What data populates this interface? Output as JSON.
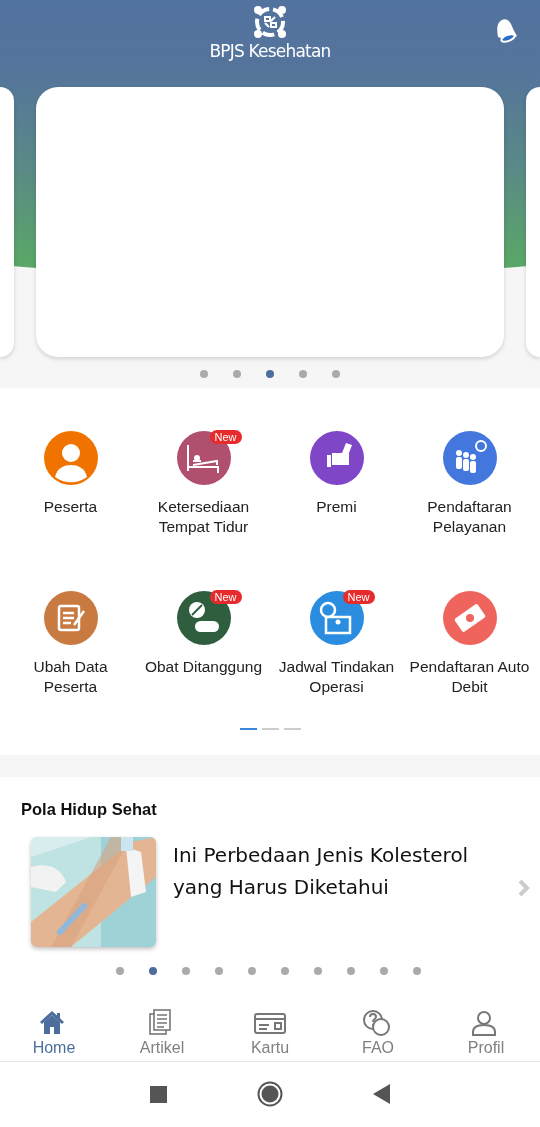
{
  "header": {
    "title": "BPJS Kesehatan"
  },
  "banner": {
    "dots": [
      {
        "selected": false
      },
      {
        "selected": false
      },
      {
        "selected": true
      },
      {
        "selected": false
      },
      {
        "selected": false
      }
    ]
  },
  "menu": {
    "items": [
      {
        "label": "Peserta",
        "color": "#f07300"
      },
      {
        "label": "Ketersediaan Tempat Tidur",
        "color": "#b0506e",
        "badge": "New"
      },
      {
        "label": "Premi",
        "color": "#8046c8"
      },
      {
        "label": "Pendaftaran Pelayanan",
        "color": "#4477dd"
      },
      {
        "label": "Ubah Data Peserta",
        "color": "#c87a40"
      },
      {
        "label": "Obat Ditanggung",
        "color": "#2e5e3e",
        "badge": "New"
      },
      {
        "label": "Jadwal Tindakan Operasi",
        "color": "#2a8de0",
        "badge": "New"
      },
      {
        "label": "Pendaftaran Auto Debit",
        "color": "#f0645e"
      }
    ],
    "pages": [
      {
        "selected": true
      },
      {
        "selected": false
      },
      {
        "selected": false
      }
    ]
  },
  "articles": {
    "title": "Pola Hidup Sehat",
    "items": [
      {
        "kind": "picture",
        "title": "Ini Perbedaan Jenis Kolesterol yang Harus Diketahui"
      }
    ],
    "dots": [
      {
        "selected": false
      },
      {
        "selected": true
      },
      {
        "selected": false
      },
      {
        "selected": false
      },
      {
        "selected": false
      },
      {
        "selected": false
      },
      {
        "selected": false
      },
      {
        "selected": false
      },
      {
        "selected": false
      },
      {
        "selected": false
      }
    ]
  },
  "bottom_nav": [
    {
      "label": "Home",
      "selected": true
    },
    {
      "label": "Artikel",
      "selected": false
    },
    {
      "label": "Kartu",
      "selected": false
    },
    {
      "label": "FAO",
      "selected": false
    },
    {
      "label": "Profil",
      "selected": false
    }
  ]
}
